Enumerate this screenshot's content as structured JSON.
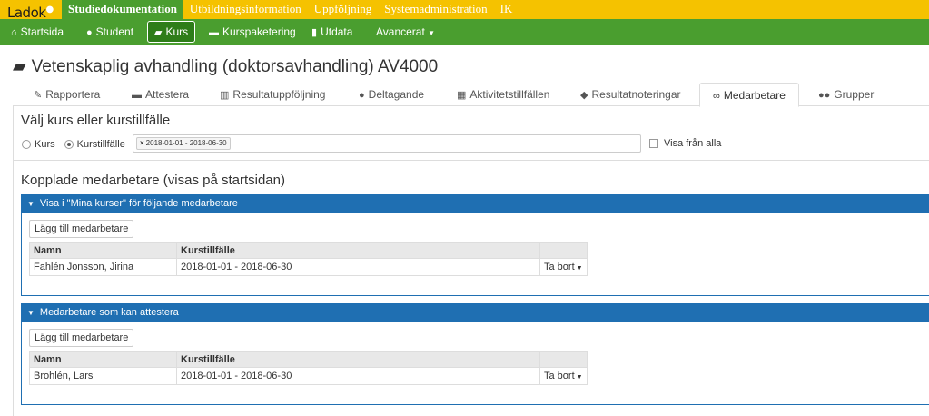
{
  "top": {
    "logo": "Ladok",
    "items": [
      "Studiedokumentation",
      "Utbildningsinformation",
      "Uppföljning",
      "Systemadministration",
      "IK"
    ]
  },
  "nav": {
    "items": [
      "Startsida",
      "Student",
      "Kurs",
      "Kurspaketering",
      "Utdata",
      "Avancerat"
    ]
  },
  "page": {
    "title": "Vetenskaplig avhandling (doktorsavhandling) AV4000"
  },
  "tabs": [
    "Rapportera",
    "Attestera",
    "Resultatuppföljning",
    "Deltagande",
    "Aktivitetstillfällen",
    "Resultatnoteringar",
    "Medarbetare",
    "Grupper"
  ],
  "select": {
    "heading": "Välj kurs eller kurstillfälle",
    "radio_kurs": "Kurs",
    "radio_kurstillfalle": "Kurstillfälle",
    "chip": "2018-01-01 - 2018-06-30",
    "show_all": "Visa från alla"
  },
  "kopplade": {
    "heading": "Kopplade medarbetare (visas på startsidan)"
  },
  "panel1": {
    "title": "Visa i \"Mina kurser\" för följande medarbetare",
    "button": "Lägg till medarbetare",
    "columns": [
      "Namn",
      "Kurstillfälle",
      ""
    ],
    "rows": [
      {
        "name": "Fahlén Jonsson, Jirina",
        "period": "2018-01-01 - 2018-06-30",
        "action": "Ta bort"
      }
    ]
  },
  "panel2": {
    "title": "Medarbetare som kan attestera",
    "button": "Lägg till medarbetare",
    "columns": [
      "Namn",
      "Kurstillfälle",
      ""
    ],
    "rows": [
      {
        "name": "Brohlén, Lars",
        "period": "2018-01-01 - 2018-06-30",
        "action": "Ta bort"
      }
    ]
  }
}
